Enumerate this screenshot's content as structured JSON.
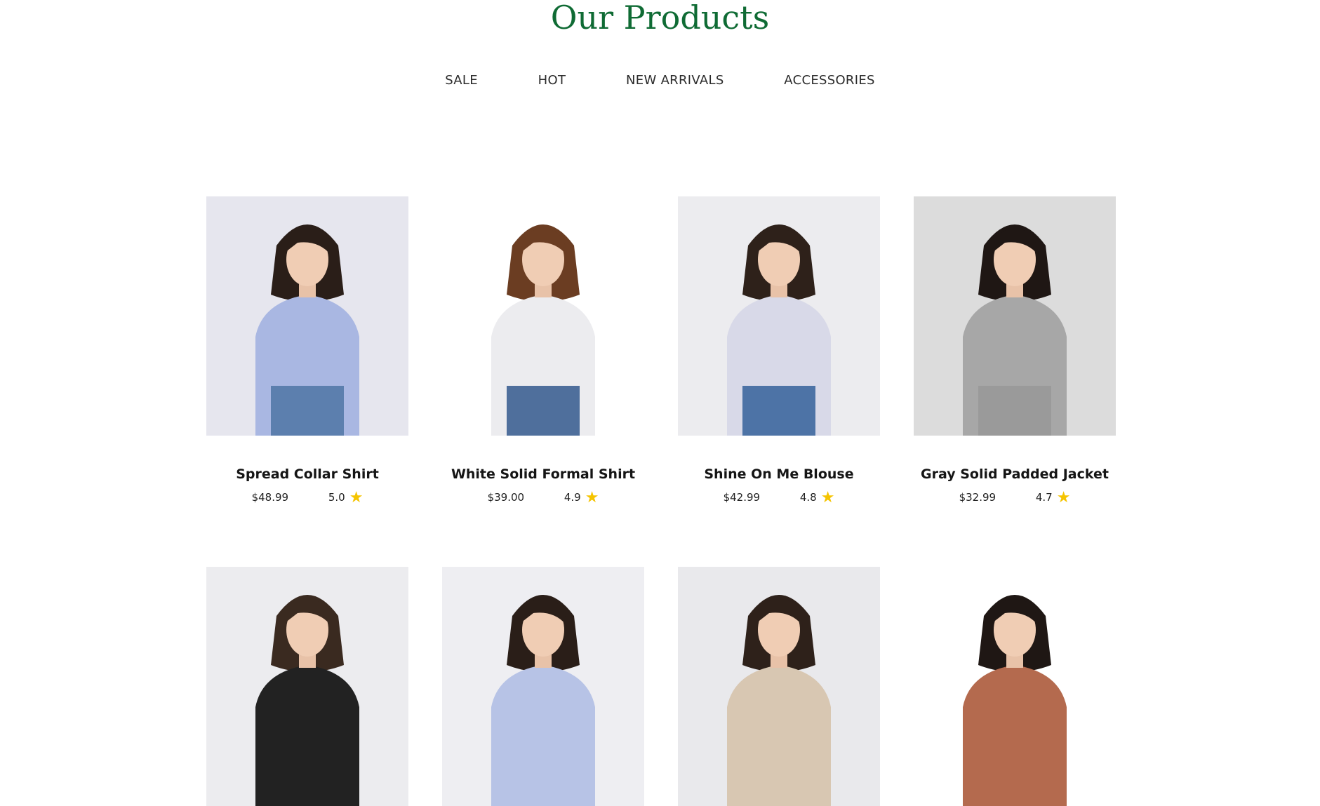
{
  "section": {
    "title": "Our Products",
    "tabs": [
      {
        "label": "SALE"
      },
      {
        "label": "HOT"
      },
      {
        "label": "NEW ARRIVALS"
      },
      {
        "label": "ACCESSORIES"
      }
    ]
  },
  "colors": {
    "title": "#0f6b34",
    "star": "#f5c400"
  },
  "icons": {
    "rating": "star-icon"
  },
  "products": [
    {
      "name": "Spread Collar Shirt",
      "price": "$48.99",
      "rating": "5.0",
      "bg": "#e6e6ee",
      "hair": "#2a1e18",
      "top": "#a9b7e2",
      "bottom": "#5c7fae"
    },
    {
      "name": "White Solid Formal Shirt",
      "price": "$39.00",
      "rating": "4.9",
      "bg": "#ffffff",
      "hair": "#6b3d22",
      "top": "#ececef",
      "bottom": "#4f6f9c"
    },
    {
      "name": "Shine On Me Blouse",
      "price": "$42.99",
      "rating": "4.8",
      "bg": "#ececef",
      "hair": "#2e211a",
      "top": "#d8d9e8",
      "bottom": "#4d73a6"
    },
    {
      "name": "Gray Solid Padded Jacket",
      "price": "$32.99",
      "rating": "4.7",
      "bg": "#dcdcdc",
      "hair": "#1f1714",
      "top": "#a7a7a7",
      "bottom": "#9a9a9a"
    },
    {
      "name": "",
      "price": "",
      "rating": "",
      "bg": "#ececef",
      "hair": "#3a2a20",
      "top": "#222222",
      "bottom": "#222222"
    },
    {
      "name": "",
      "price": "",
      "rating": "",
      "bg": "#eeeef2",
      "hair": "#2a1e18",
      "top": "#b7c3e6",
      "bottom": "#b7c3e6"
    },
    {
      "name": "",
      "price": "",
      "rating": "",
      "bg": "#e9e9ec",
      "hair": "#2e211a",
      "top": "#d8c7b2",
      "bottom": "#d8c7b2"
    },
    {
      "name": "",
      "price": "",
      "rating": "",
      "bg": "#ffffff",
      "hair": "#1f1714",
      "top": "#b46a4e",
      "bottom": "#b46a4e"
    }
  ]
}
